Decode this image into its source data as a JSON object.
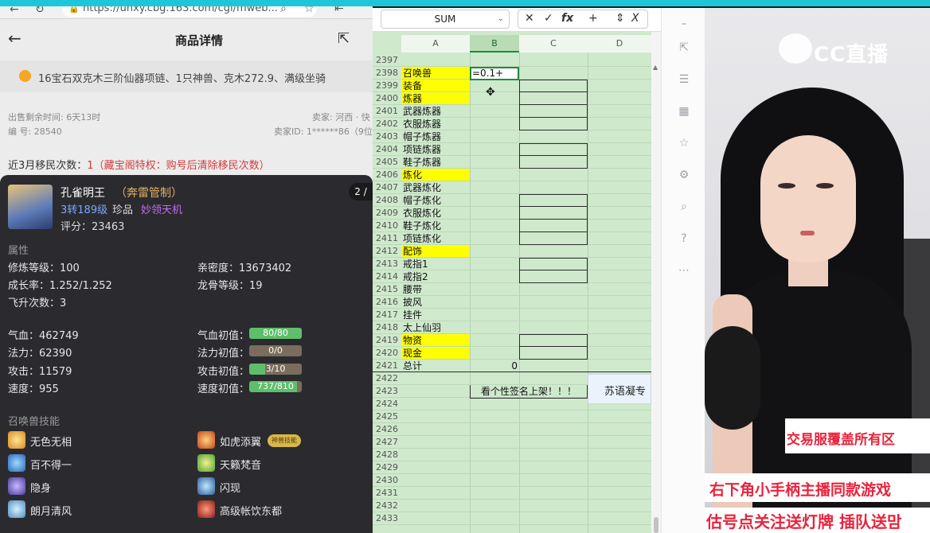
{
  "browser": {
    "url": "https://unxy.cbg.163.com/cgi/mweb...",
    "page_title": "商品详情",
    "item_title": "16宝石双克木三阶仙器项链、1只神兽、克木272.9、满级坐骑",
    "meta": {
      "sale_remaining": "出售剩余时间: 6天13时",
      "seller_server": "卖家: 河西 · 快",
      "serial": "编 号: 28540",
      "seller_id": "卖家ID: 1******86（9位"
    },
    "migration": {
      "label": "近3月移民次数：",
      "count": "1",
      "note": "（藏宝阁特权：购号后清除移民次数）"
    }
  },
  "pet": {
    "name": "孔雀明王",
    "tag": "（奔雷管制）",
    "level": "3转189级",
    "rarity": "珍品",
    "special": "妙领天机",
    "score": "评分：23463",
    "pager": "2 /",
    "attr_title": "属性",
    "attrs": {
      "cultivation": "修炼等级：100",
      "intimacy": "亲密度：13673402",
      "growth": "成长率：1.252/1.252",
      "dragon_bone": "龙骨等级：19",
      "ascend": "飞升次数：3",
      "hp": "气血：462749",
      "mp": "法力：62390",
      "atk": "攻击：11579",
      "spd": "速度：955"
    },
    "init": {
      "hp_label": "气血初值：",
      "hp_bar": "80/80",
      "hp_frac": 1.0,
      "mp_label": "法力初值：",
      "mp_bar": "0/0",
      "mp_frac": 0.0,
      "atk_label": "攻击初值：",
      "atk_bar": "3/10",
      "atk_frac": 0.3,
      "spd_label": "速度初值：",
      "spd_bar": "737/810",
      "spd_frac": 0.91
    },
    "skill_title": "召唤兽技能",
    "skills_left": [
      "无色无相",
      "百不得一",
      "隐身",
      "朗月清风"
    ],
    "skills_right": [
      "如虎添翼",
      "天籁梵音",
      "闪现",
      "高级帐饮东都"
    ],
    "badge": "神兽技能"
  },
  "sheet": {
    "namebox": "SUM",
    "fx_symbols": [
      "✕",
      "✓",
      "fx",
      "+",
      "⇕",
      "X"
    ],
    "columns": [
      "A",
      "B",
      "C",
      "D"
    ],
    "rows": [
      {
        "n": "2397",
        "a": "",
        "yellow": false
      },
      {
        "n": "2398",
        "a": "召唤兽",
        "yellow": true
      },
      {
        "n": "2399",
        "a": "装备",
        "yellow": true
      },
      {
        "n": "2400",
        "a": "炼器",
        "yellow": true
      },
      {
        "n": "2401",
        "a": "武器炼器",
        "yellow": false
      },
      {
        "n": "2402",
        "a": "衣服炼器",
        "yellow": false
      },
      {
        "n": "2403",
        "a": "帽子炼器",
        "yellow": false
      },
      {
        "n": "2404",
        "a": "项链炼器",
        "yellow": false
      },
      {
        "n": "2405",
        "a": "鞋子炼器",
        "yellow": false
      },
      {
        "n": "2406",
        "a": "炼化",
        "yellow": true
      },
      {
        "n": "2407",
        "a": "武器炼化",
        "yellow": false
      },
      {
        "n": "2408",
        "a": "帽子炼化",
        "yellow": false
      },
      {
        "n": "2409",
        "a": "衣服炼化",
        "yellow": false
      },
      {
        "n": "2410",
        "a": "鞋子炼化",
        "yellow": false
      },
      {
        "n": "2411",
        "a": "项链炼化",
        "yellow": false
      },
      {
        "n": "2412",
        "a": "配饰",
        "yellow": true
      },
      {
        "n": "2413",
        "a": "戒指1",
        "yellow": false
      },
      {
        "n": "2414",
        "a": "戒指2",
        "yellow": false
      },
      {
        "n": "2415",
        "a": "腰带",
        "yellow": false
      },
      {
        "n": "2416",
        "a": "披风",
        "yellow": false
      },
      {
        "n": "2417",
        "a": "挂件",
        "yellow": false
      },
      {
        "n": "2418",
        "a": "太上仙羽",
        "yellow": false
      },
      {
        "n": "2419",
        "a": "物资",
        "yellow": true
      },
      {
        "n": "2420",
        "a": "现金",
        "yellow": true
      },
      {
        "n": "2421",
        "a": "总计",
        "yellow": false,
        "b": "0"
      },
      {
        "n": "2422",
        "a": "",
        "yellow": false
      },
      {
        "n": "2423",
        "a": "",
        "yellow": false
      },
      {
        "n": "2424",
        "a": "",
        "yellow": false
      },
      {
        "n": "2425",
        "a": "",
        "yellow": false
      },
      {
        "n": "2426",
        "a": "",
        "yellow": false
      },
      {
        "n": "2427",
        "a": "",
        "yellow": false
      },
      {
        "n": "2428",
        "a": "",
        "yellow": false
      },
      {
        "n": "2429",
        "a": "",
        "yellow": false
      },
      {
        "n": "2430",
        "a": "",
        "yellow": false
      },
      {
        "n": "2431",
        "a": "",
        "yellow": false
      },
      {
        "n": "2432",
        "a": "",
        "yellow": false
      },
      {
        "n": "2433",
        "a": "",
        "yellow": false
      }
    ],
    "editing_value": "=0.1+",
    "sign_text": "看个性签名上架！！！",
    "float_note": "苏语凝专"
  },
  "stream": {
    "logo_text": "CC直播",
    "banner1": "交易服覆盖所有区",
    "banner2": "右下角小手柄主播同款游戏",
    "banner3": "估号点关注送灯牌 插队送맘"
  },
  "colors": {
    "accent": "#1f8b3c",
    "yellow": "#ffff00",
    "sheet_bg": "#cfe9cd",
    "banner_red": "#e8243c"
  }
}
